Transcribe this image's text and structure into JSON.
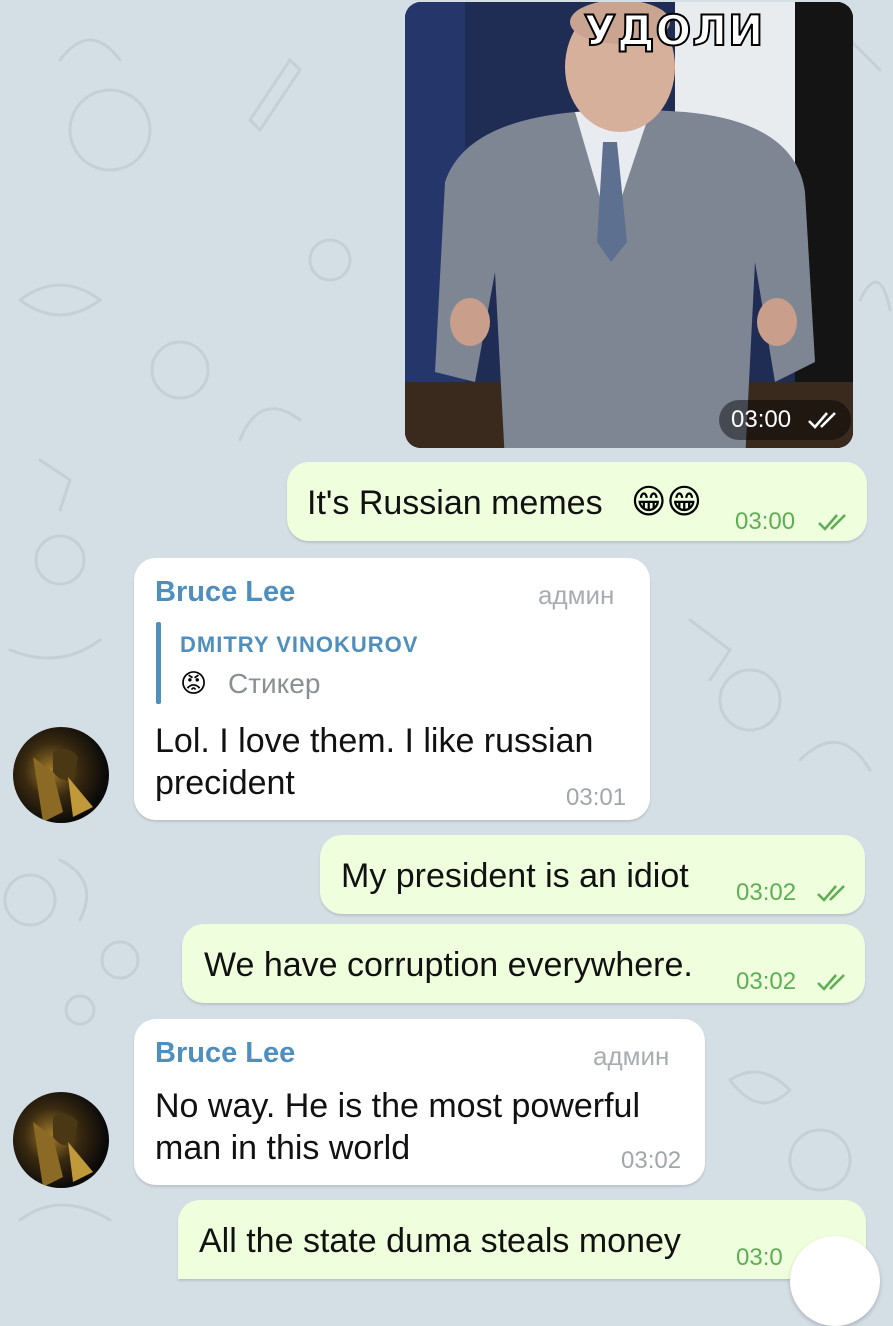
{
  "messages": {
    "m1": {
      "image_caption": "УДОЛИ",
      "time": "03:00"
    },
    "m2": {
      "text": "It's Russian memes",
      "emoji": "😁😁",
      "time": "03:00"
    },
    "m3": {
      "sender": "Bruce Lee",
      "role": "админ",
      "reply_author": "DMITRY VINOKUROV",
      "reply_emoji": "😡",
      "reply_text": "Стикер",
      "text": "Lol. I love them. I like russian precident",
      "time": "03:01"
    },
    "m4": {
      "text": "My president is an idiot",
      "time": "03:02"
    },
    "m5": {
      "text": "We have corruption everywhere.",
      "time": "03:02"
    },
    "m6": {
      "sender": "Bruce Lee",
      "role": "админ",
      "text": "No way. He is the most powerful man in this world",
      "time": "03:02"
    },
    "m7": {
      "text": "All the state duma steals money",
      "time": "03:0"
    }
  },
  "colors": {
    "background": "#d4dee5",
    "outgoing_bubble": "#efffde",
    "incoming_bubble": "#ffffff",
    "outgoing_time": "#5fae56",
    "sender_name": "#4f8fbe",
    "reply_bar": "#4f8fbe"
  },
  "icons": {
    "read_checks": "double-check-icon",
    "avatar": "avatar"
  }
}
